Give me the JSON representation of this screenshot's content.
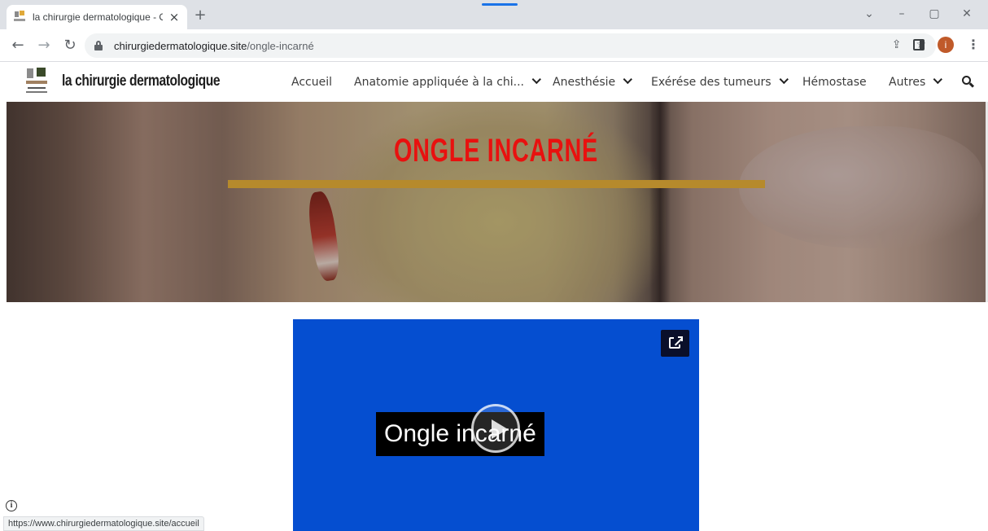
{
  "browser": {
    "tab_title": "la chirurgie dermatologique - O",
    "tab_close": "×",
    "new_tab": "+",
    "url_host": "chirurgiedermatologique.site",
    "url_path": "/ongle-incarné",
    "window_controls": [
      "⌄",
      "–",
      "▢",
      "✕"
    ],
    "avatar_letter": "i",
    "status_url": "https://www.chirurgiedermatologique.site/accueil"
  },
  "site": {
    "title": "la chirurgie dermatologique",
    "nav": [
      {
        "label": "Accueil",
        "has_dropdown": false
      },
      {
        "label": "Anatomie appliquée à la chi...",
        "has_dropdown": true
      },
      {
        "label": "Anesthésie",
        "has_dropdown": true
      },
      {
        "label": "Exérése des tumeurs",
        "has_dropdown": true
      },
      {
        "label": "Hémostase",
        "has_dropdown": false
      },
      {
        "label": "Autres",
        "has_dropdown": true
      }
    ]
  },
  "hero": {
    "title": "ONGLE INCARNÉ",
    "title_color": "#e8110f",
    "bar_color": "#b68a2c"
  },
  "video": {
    "caption": "Ongle incarné",
    "background_color": "#054ed0"
  },
  "icons": [
    "back-arrow-icon",
    "forward-arrow-icon",
    "reload-icon",
    "lock-icon",
    "share-icon",
    "star-icon",
    "side-panel-icon",
    "menu-kebab-icon",
    "search-icon",
    "chevron-down-icon",
    "external-link-icon",
    "play-icon",
    "info-icon"
  ]
}
